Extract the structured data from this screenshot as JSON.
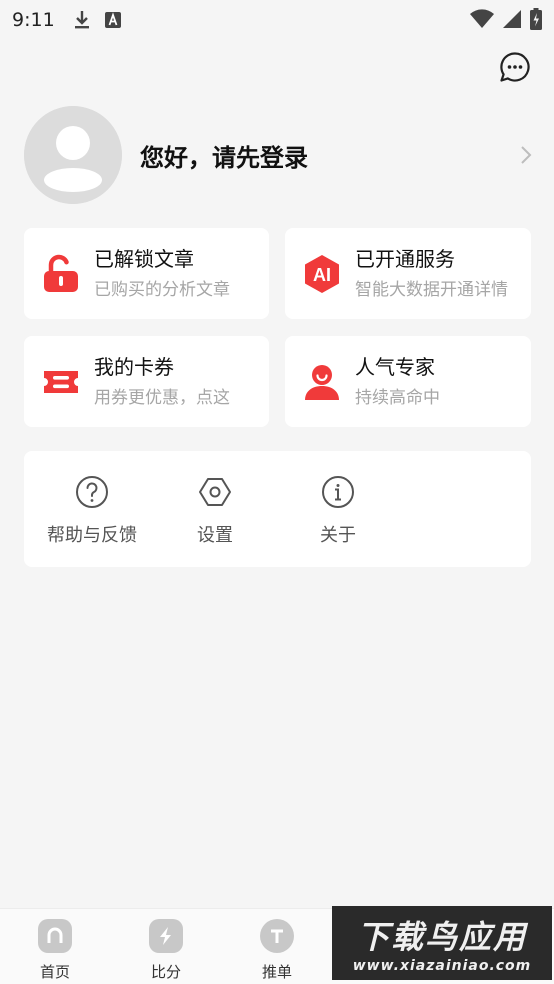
{
  "status_bar": {
    "time": "9:11",
    "icons": [
      "download-icon",
      "a-badge-icon",
      "wifi-icon",
      "signal-icon",
      "battery-charging-icon"
    ]
  },
  "header": {
    "message_icon": "chat-bubble-icon"
  },
  "profile": {
    "greeting": "您好，请先登录"
  },
  "cards": [
    {
      "title": "已解锁文章",
      "subtitle": "已购买的分析文章",
      "icon": "unlock-icon"
    },
    {
      "title": "已开通服务",
      "subtitle": "智能大数据开通详情",
      "icon": "ai-badge-icon",
      "icon_text": "AI"
    },
    {
      "title": "我的卡券",
      "subtitle": "用券更优惠，点这",
      "icon": "ticket-icon"
    },
    {
      "title": "人气专家",
      "subtitle": "持续高命中",
      "icon": "expert-icon"
    }
  ],
  "tools": [
    {
      "label": "帮助与反馈",
      "icon": "help-icon"
    },
    {
      "label": "设置",
      "icon": "settings-icon"
    },
    {
      "label": "关于",
      "icon": "info-icon"
    }
  ],
  "tabbar": [
    {
      "label": "首页",
      "icon": "home-icon"
    },
    {
      "label": "比分",
      "icon": "lightning-icon"
    },
    {
      "label": "推单",
      "icon": "t-circle-icon"
    }
  ],
  "watermark": {
    "main": "下载鸟应用",
    "url": "www.xiazainiao.com"
  },
  "colors": {
    "accent": "#f03a3a",
    "background": "#f5f5f5",
    "card": "#ffffff",
    "muted_text": "#a6a6a6"
  }
}
